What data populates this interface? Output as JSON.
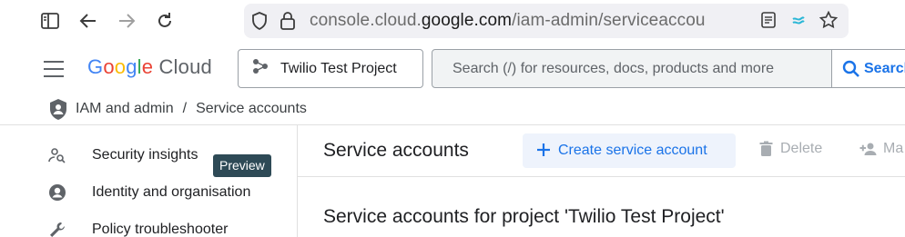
{
  "browser": {
    "url_prefix": "console.cloud.",
    "url_host": "google.com",
    "url_path": "/iam-admin/serviceaccou",
    "icons": [
      "sidebar-icon",
      "back-icon",
      "forward-icon",
      "reload-icon",
      "shield-icon",
      "lock-icon",
      "reader-mode-icon",
      "extension-icon",
      "bookmark-star-icon"
    ]
  },
  "header": {
    "logo_letters": [
      "G",
      "o",
      "o",
      "g",
      "l",
      "e"
    ],
    "logo_product": "Cloud",
    "project_name": "Twilio Test Project",
    "search_placeholder": "Search (/) for resources, docs, products and more",
    "search_button": "Search"
  },
  "breadcrumb": {
    "section": "IAM and admin",
    "separator": "/",
    "page": "Service accounts"
  },
  "sidebar": {
    "items": [
      {
        "label": "Security insights",
        "badge": "Preview",
        "icon": "security-insights-icon"
      },
      {
        "label": "Identity and organisation",
        "icon": "account-circle-icon"
      },
      {
        "label": "Policy troubleshooter",
        "icon": "wrench-icon"
      }
    ]
  },
  "main": {
    "title": "Service accounts",
    "create_label": "Create service account",
    "delete_label": "Delete",
    "manage_label": "Ma",
    "section_title": "Service accounts for project 'Twilio Test Project'"
  },
  "colors": {
    "accent": "#1a73e8",
    "badge_bg": "#2e4a56",
    "disabled": "#a8adb2"
  }
}
